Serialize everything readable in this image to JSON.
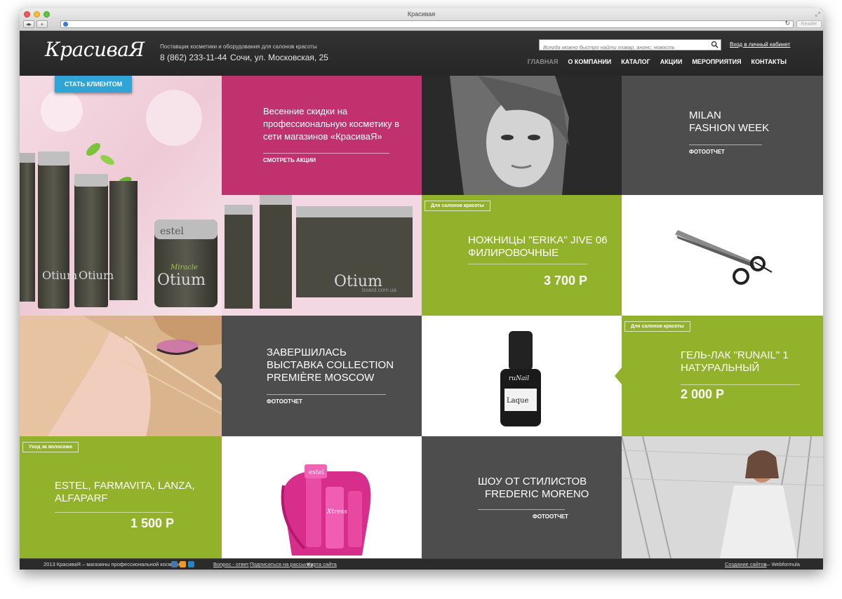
{
  "browser": {
    "title": "Красивая",
    "reader_label": "Reader"
  },
  "header": {
    "logo": "КрасиваЯ",
    "tagline": "Поставщик косметики и оборудования для салонов красоты",
    "phone": "8 (862) 233-11-44",
    "address": "Сочи, ул. Московская, 25",
    "search_placeholder": "Всегда можно быстро найти товар, анонс, новость",
    "login_link": "Вход в личный кабинет",
    "nav": [
      {
        "label": "ГЛАВНАЯ",
        "active": true
      },
      {
        "label": "О КОМПАНИИ"
      },
      {
        "label": "КАТАЛОГ"
      },
      {
        "label": "АКЦИИ"
      },
      {
        "label": "МЕРОПРИЯТИЯ"
      },
      {
        "label": "КОНТАКТЫ"
      }
    ]
  },
  "cta_button": "СТАТЬ КЛИЕНТОМ",
  "tiles": {
    "promo": {
      "title": "Весенние скидки на профессиональную косметику в сети магазинов «КрасиваЯ»",
      "link": "СМОТРЕТЬ АКЦИИ"
    },
    "milan": {
      "title_line1": "MILAN",
      "title_line2": "FASHION WEEK",
      "link": "ФОТООТЧЕТ"
    },
    "scissors": {
      "tag": "Для салонов красоты",
      "title_line1": "НОЖНИЦЫ \"ERIKA\" JIVE 06",
      "title_line2": "ФИЛИРОВОЧНЫЕ",
      "price": "3 700 Р"
    },
    "collection": {
      "title_line1": "ЗАВЕРШИЛАСЬ",
      "title_line2": "ВЫСТАВКА COLLECTION",
      "title_line3": "PREMIÈRE MOSCOW",
      "link": "ФОТООТЧЕТ"
    },
    "gel": {
      "tag": "Для салонов красоты",
      "title_line1": "ГЕЛЬ-ЛАК \"RUNAIL\" 1",
      "title_line2": "НАТУРАЛЬНЫЙ",
      "price": "2 000 Р"
    },
    "hair": {
      "tag": "Уход за волосами",
      "title_line1": "ESTEL, FARMAVITA, LANZA,",
      "title_line2": "ALFAPARF",
      "price": "1 500 Р"
    },
    "show": {
      "title_line1": "ШОУ ОТ СТИЛИСТОВ",
      "title_line2": "FREDERIC MORENO",
      "link": "ФОТООТЧЕТ"
    }
  },
  "product_text": {
    "brand": "estel",
    "line": "Otium",
    "series": "Miracle",
    "watermark": "board.com.ua",
    "polish_brand": "ruNail",
    "polish_label": "Laque",
    "bag_brand": "estel",
    "bag_label": "Xtress"
  },
  "footer": {
    "copyright": "2013 КрасиваЯ – магазины профессиональной косметики",
    "links": [
      "Вопрос - ответ",
      "Подписаться на рассылку",
      "Карта сайта"
    ],
    "credit_link": "Создание сайтов",
    "credit_suffix": "— Webformula"
  },
  "colors": {
    "pink": "#c1316d",
    "green": "#92b22b",
    "dark": "#4d4d4d",
    "cta": "#2ea4d7"
  }
}
